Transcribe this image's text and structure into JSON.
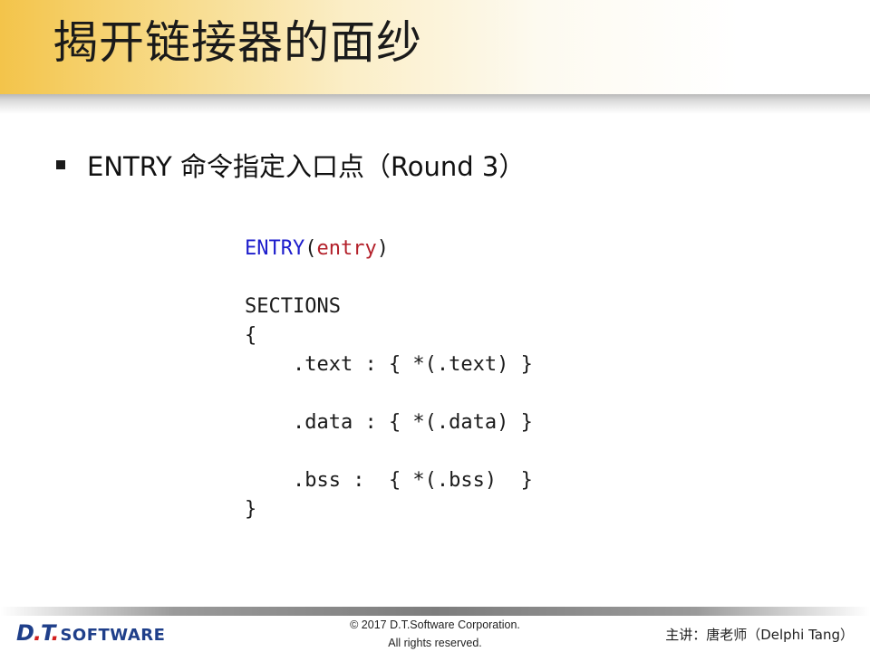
{
  "title": "揭开链接器的面纱",
  "bullet": "ENTRY 命令指定入口点（Round 3）",
  "code": {
    "entry_keyword": "ENTRY",
    "entry_open": "(",
    "entry_arg": "entry",
    "entry_close": ")",
    "sections_keyword": "SECTIONS",
    "open_brace": "{",
    "text_line": "    .text : { *(.text) }",
    "data_line": "    .data : { *(.data) }",
    "bss_line": "    .bss :  { *(.bss)  }",
    "close_brace": "}"
  },
  "footer": {
    "logo_prefix_d": "D",
    "logo_dot1": ".",
    "logo_t": "T",
    "logo_dot2": ".",
    "logo_software": "SOFTWARE",
    "copyright_line1": "© 2017 D.T.Software Corporation.",
    "copyright_line2": "All rights reserved.",
    "presenter": "主讲：唐老师（Delphi Tang）"
  },
  "colors": {
    "title_gradient_start": "#f3c44a",
    "keyword": "#1d1dcc",
    "argument": "#b3202a",
    "logo_blue": "#1f3f8a",
    "logo_red": "#d2201f"
  }
}
